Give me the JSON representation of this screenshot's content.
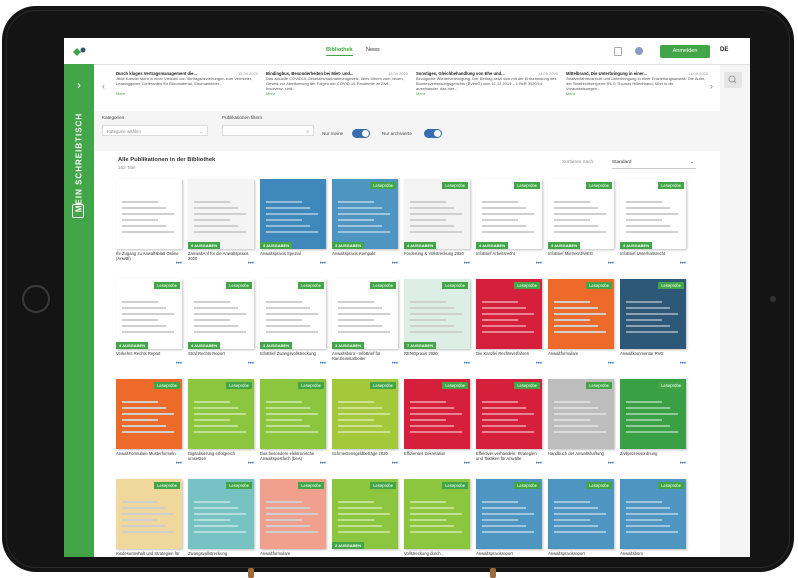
{
  "topbar": {
    "tabs": [
      "Bibliothek",
      "News"
    ],
    "login_label": "Anmelden",
    "lang": "DE"
  },
  "sidebar": {
    "label": "MEIN SCHREIBTISCH"
  },
  "news": [
    {
      "title": "Durch kluges Vertragsmanagement die...",
      "date": "15.09.2020",
      "text": "Jede Kanzlei steht in einer Vielzahl von Vertragsbeziehungen zum Vermieter, Leasinggeber, Lieferanten für Büromaterial, Stromanbieter..."
    },
    {
      "title": "Bindingbus, Besonderheiten bei Miet- und...",
      "date": "15.09.2020",
      "text": "Das aktuelle COVID19-Gesetzesmaßnahmengesetz, Alles führen zum neuen, Gesetz zur Abmilderung der Folgen der COVID-19-Pandemie im Zivil-, Insolvenz- und..."
    },
    {
      "title": "Sonstiges, Gleichbehandlung von Ehe und...",
      "date": "14.09.2020",
      "text": "Bezügliche Wiedervereinigung: Der Beitrag setzt sich mit der Entscheidung des Bundesverfassungsgerichts (BVerfG) vom 11.12.2019 – 1 BvR 3020/14 auseinander, das hier..."
    },
    {
      "title": "Mittelbrand, Die Unterbringung in einer...",
      "date": "11.09.2020",
      "text": "Strafverfahrensrecht und Unterbringung in einer Entziehungsanstalt: Die Autor, der Strafrechtsexperte RiLG Thomas Hillenbrand, führt in die Voraussetzungen..."
    }
  ],
  "news_more": "Mehr",
  "filters": {
    "category_label": "Kategorien",
    "category_placeholder": "Kategorie wählen",
    "pub_label": "Publikationen filtern",
    "only_mine": "Nur meine",
    "only_archived": "Nur archivierte"
  },
  "library": {
    "title": "Alle Publikationen in der Bibliothek",
    "count": "162 Titel",
    "sort_label": "Sortieren nach:",
    "sort_value": "Standard"
  },
  "cards": [
    {
      "title": "Ihr Zugang zu Anwaltsblatt Online (AnwBl)",
      "ribbon": "",
      "badge": "",
      "color": "#ffffff"
    },
    {
      "title": "ZanwaltAnf für die Anwaltspraxis 2020",
      "ribbon": "",
      "badge": "9 AUSGABEN",
      "color": "#f4f4f4"
    },
    {
      "title": "Anwaltspraxis Spezial",
      "ribbon": "",
      "badge": "3 AUSGABEN",
      "color": "#3f88bb"
    },
    {
      "title": "Anwaltspraxis Kompakt",
      "ribbon": "Leseprobe",
      "badge": "3 AUSGABEN",
      "color": "#4f95c2"
    },
    {
      "title": "Forderung & Vollstreckung 2020",
      "ribbon": "Leseprobe",
      "badge": "4 AUSGABEN",
      "color": "#f3f3f3"
    },
    {
      "title": "InfoBrief Arbeitsrecht",
      "ribbon": "Leseprobe",
      "badge": "4 AUSGABEN",
      "color": "#ffffff"
    },
    {
      "title": "InfoBrief Mietrecht/WEG",
      "ribbon": "Leseprobe",
      "badge": "3 AUSGABEN",
      "color": "#ffffff"
    },
    {
      "title": "InfoBrief Unterhaltsrecht",
      "ribbon": "Leseprobe",
      "badge": "3 AUSGABEN",
      "color": "#ffffff"
    },
    {
      "title": "Verkehrs Rechts Report",
      "ribbon": "Leseprobe",
      "badge": "4 AUSGABEN",
      "color": "#ffffff"
    },
    {
      "title": "Straf Rechts Report",
      "ribbon": "Leseprobe",
      "badge": "4 AUSGABEN",
      "color": "#ffffff"
    },
    {
      "title": "InfoBrief Zwangsvollstreckung",
      "ribbon": "Leseprobe",
      "badge": "3 AUSGABEN",
      "color": "#ffffff"
    },
    {
      "title": "Anwaltsbüro - InfoBrief für Kanzleimitarbeiter",
      "ribbon": "Leseprobe",
      "badge": "3 AUSGABEN",
      "color": "#ffffff"
    },
    {
      "title": "RENOpraxis 2020",
      "ribbon": "Leseprobe",
      "badge": "7 AUSGABEN",
      "color": "#dceee6"
    },
    {
      "title": "Die Kanzlei Rechtsverfahren",
      "ribbon": "Leseprobe",
      "badge": "",
      "color": "#d61f3a"
    },
    {
      "title": "Anwaltformulare",
      "ribbon": "Leseprobe",
      "badge": "",
      "color": "#ee6a2b"
    },
    {
      "title": "Anwaltkommentar RVG",
      "ribbon": "Leseprobe",
      "badge": "",
      "color": "#2d5878"
    },
    {
      "title": "AnwaltFormulare Musterformeln",
      "ribbon": "Leseprobe",
      "badge": "",
      "color": "#ee6a2b"
    },
    {
      "title": "Digitalisierung erfolgreich umsetzen",
      "ribbon": "Leseprobe",
      "badge": "",
      "color": "#8cc63e"
    },
    {
      "title": "Das besondere elektronische Anwaltspostfach (beA)",
      "ribbon": "Leseprobe",
      "badge": "",
      "color": "#8cc63e"
    },
    {
      "title": "Schmerzensgeldbeträge 2020",
      "ribbon": "Leseprobe",
      "badge": "",
      "color": "#a3c93a"
    },
    {
      "title": "Effizientes Sekretariat",
      "ribbon": "Leseprobe",
      "badge": "",
      "color": "#d61f3a"
    },
    {
      "title": "Effektiver verhandeln: Strategien und Taktiken für Anwälte",
      "ribbon": "Leseprobe",
      "badge": "",
      "color": "#d61f3a"
    },
    {
      "title": "Handbuch der Anwaltshaftung",
      "ribbon": "Leseprobe",
      "badge": "",
      "color": "#bdbdbd"
    },
    {
      "title": "Zivilprozessordnung",
      "ribbon": "Leseprobe",
      "badge": "",
      "color": "#3aa046"
    },
    {
      "title": "Kindesunterhalt und Strategien für Junge",
      "ribbon": "Leseprobe",
      "badge": "",
      "color": "#f0d89c"
    },
    {
      "title": "Zwangsvollstreckung",
      "ribbon": "Leseprobe",
      "badge": "",
      "color": "#77c3c3"
    },
    {
      "title": "Anwaltformulare",
      "ribbon": "Leseprobe",
      "badge": "",
      "color": "#f0a08c"
    },
    {
      "title": "",
      "ribbon": "Leseprobe",
      "badge": "2 AUSGABEN",
      "color": "#8cc63e"
    },
    {
      "title": "Vollstreckung durch...",
      "ribbon": "Leseprobe",
      "badge": "",
      "color": "#8cc63e"
    },
    {
      "title": "Anwaltspraxisreport",
      "ribbon": "Leseprobe",
      "badge": "",
      "color": "#4f95c2"
    },
    {
      "title": "Anwaltspraxisreport",
      "ribbon": "Leseprobe",
      "badge": "",
      "color": "#4f95c2"
    },
    {
      "title": "Anwaltsbüro",
      "ribbon": "Leseprobe",
      "badge": "",
      "color": "#4f95c2"
    }
  ]
}
